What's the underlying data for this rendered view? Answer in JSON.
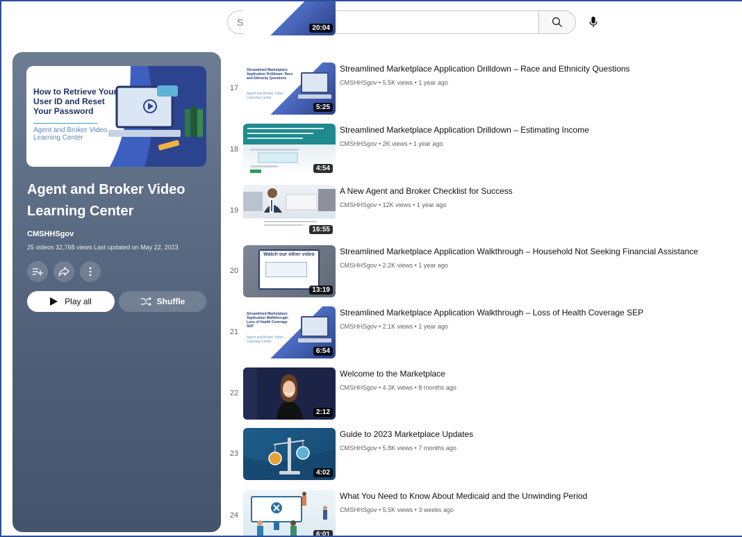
{
  "search": {
    "placeholder": "Search"
  },
  "playlist": {
    "thumb_title": "How to Retrieve Your User ID and Reset Your Password",
    "thumb_subtitle": "Agent and Broker Video Learning Center",
    "title": "Agent and Broker Video Learning Center",
    "channel": "CMSHHSgov",
    "stats": "25 videos  32,768 views  Last updated on May 22, 2023",
    "play_all_label": "Play all",
    "shuffle_label": "Shuffle"
  },
  "partial_top": {
    "duration": "20:04"
  },
  "videos": [
    {
      "index": "17",
      "title": "Streamlined Marketplace Application Drilldown – Race and Ethnicity Questions",
      "meta": "CMSHHSgov • 5.5K views • 1 year ago",
      "duration": "5:25",
      "thumb_text": "Streamlined Marketplace Application Drilldown: Race and Ethnicity Questions",
      "thumb_sub": "Agent and Broker Video Learning Center"
    },
    {
      "index": "18",
      "title": "Streamlined Marketplace Application Drilldown – Estimating Income",
      "meta": "CMSHHSgov • 2K views • 1 year ago",
      "duration": "4:54"
    },
    {
      "index": "19",
      "title": "A New Agent and Broker Checklist for Success",
      "meta": "CMSHHSgov • 12K views • 1 year ago",
      "duration": "16:55"
    },
    {
      "index": "20",
      "title": "Streamlined Marketplace Application Walkthrough – Household Not Seeking Financial Assistance",
      "meta": "CMSHHSgov • 2.2K views • 1 year ago",
      "duration": "13:19",
      "thumb_text": "Watch our other video"
    },
    {
      "index": "21",
      "title": "Streamlined Marketplace Application Walkthrough – Loss of Health Coverage SEP",
      "meta": "CMSHHSgov • 2.1K views • 1 year ago",
      "duration": "6:54",
      "thumb_text": "Streamlined Marketplace Application Walkthrough: Loss of Health Coverage SEP",
      "thumb_sub": "Agent and Broker Video Learning Center"
    },
    {
      "index": "22",
      "title": "Welcome to the Marketplace",
      "meta": "CMSHHSgov • 4.3K views • 8 months ago",
      "duration": "2:12"
    },
    {
      "index": "23",
      "title": "Guide to 2023 Marketplace Updates",
      "meta": "CMSHHSgov • 5.8K views • 7 months ago",
      "duration": "4:02"
    },
    {
      "index": "24",
      "title": "What You Need to Know About Medicaid and the Unwinding Period",
      "meta": "CMSHHSgov • 5.5K views • 3 weeks ago",
      "duration": "6:01"
    }
  ],
  "icons": {
    "search": "search-icon",
    "mic": "microphone-icon",
    "save": "save-to-playlist-icon",
    "share": "share-icon",
    "more": "more-vertical-icon",
    "play": "play-icon",
    "shuffle": "shuffle-icon"
  }
}
